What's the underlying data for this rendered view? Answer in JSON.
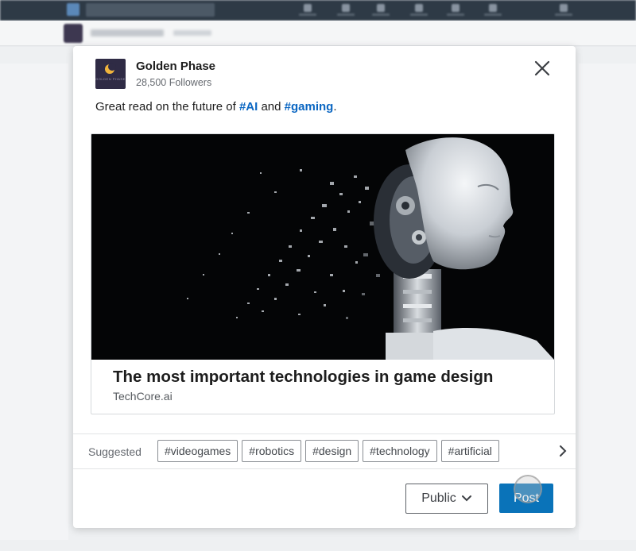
{
  "post": {
    "company_name": "Golden Phase",
    "followers": "28,500 Followers",
    "logo_text": "GOLDEN PHASE",
    "text_prefix": "Great read on the future of ",
    "hashtag_1": "#AI",
    "text_middle": " and ",
    "hashtag_2": "#gaming",
    "text_suffix": "."
  },
  "article": {
    "title": "The most important technologies in game design",
    "source": "TechCore.ai"
  },
  "suggested": {
    "label": "Suggested",
    "chips": [
      "#videogames",
      "#robotics",
      "#design",
      "#technology",
      "#artificial"
    ]
  },
  "footer": {
    "visibility_label": "Public",
    "post_label": "Post"
  },
  "icons": {
    "close": "close-icon",
    "chevron": "chevron-down-icon",
    "scroll": "chevron-right-icon"
  },
  "colors": {
    "accent": "#0a66c2",
    "post_button": "#0a73b9"
  }
}
